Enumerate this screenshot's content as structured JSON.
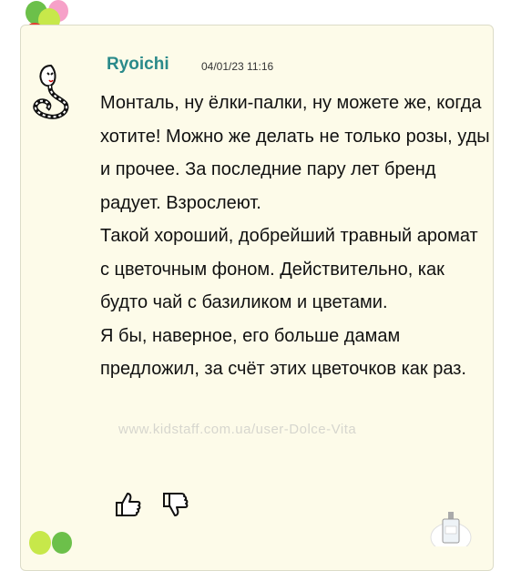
{
  "comment": {
    "author": "Ryoichi",
    "date": "04/01/23 11:16",
    "paragraphs": [
      "Монталь, ну ёлки-палки, ну можете же, когда хотите! Можно же делать не только розы, уды и прочее. За последние пару лет бренд радует. Взрослеют.",
      "Такой хороший, добрейший травный аромат с цветочным фоном. Действительно, как будто чай с базиликом и цветами.",
      "Я бы, наверное, его больше дамам предложил, за счёт этих цветочков как раз."
    ],
    "watermark": "www.kidstaff.com.ua/user-Dolce-Vita",
    "actions": {
      "like_icon": "thumbs-up-icon",
      "dislike_icon": "thumbs-down-icon"
    }
  },
  "decorations": {
    "avatar_icon": "cobra-icon",
    "balloons_icon": "balloons-icon",
    "bottle_icon": "perfume-bottle-icon"
  },
  "colors": {
    "card_background": "#fdfbe9",
    "author": "#2a8a8a",
    "text": "#111111"
  }
}
